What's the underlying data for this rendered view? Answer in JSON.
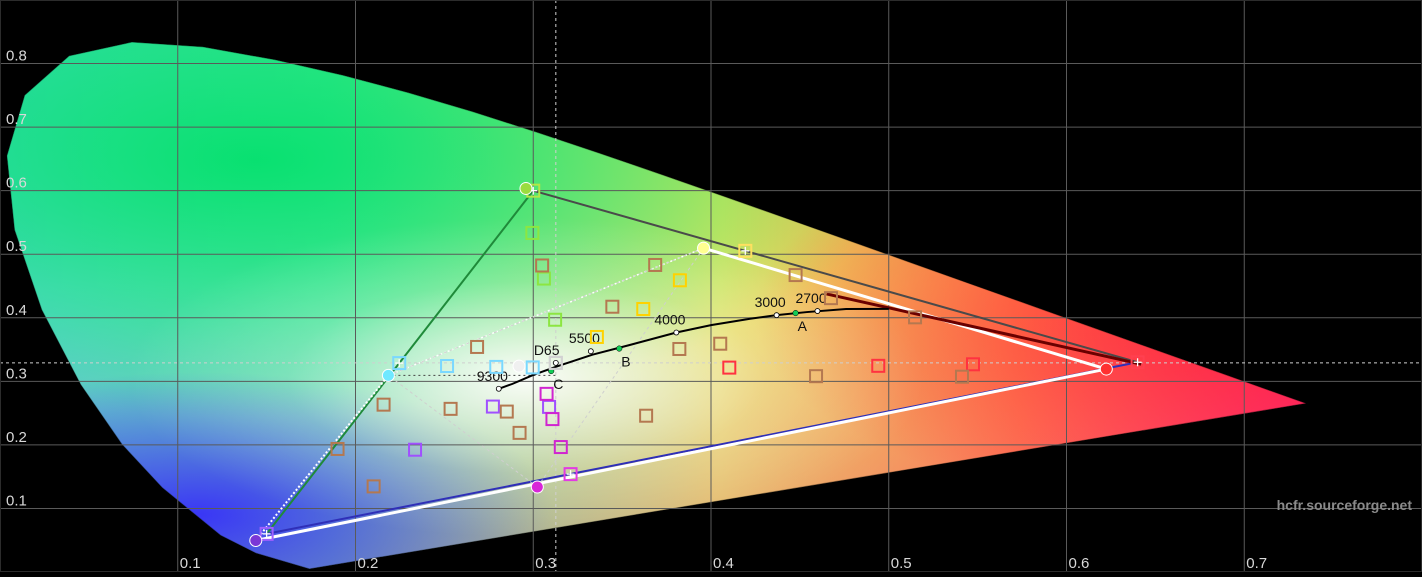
{
  "chart_data": {
    "type": "scatter",
    "xlim": [
      0,
      0.8
    ],
    "ylim": [
      0,
      0.9
    ],
    "grid": true,
    "x_ticks": [
      {
        "value": 0.1,
        "label": "0.1"
      },
      {
        "value": 0.2,
        "label": "0.2"
      },
      {
        "value": 0.3,
        "label": "0.3"
      },
      {
        "value": 0.4,
        "label": "0.4"
      },
      {
        "value": 0.5,
        "label": "0.5"
      },
      {
        "value": 0.6,
        "label": "0.6"
      },
      {
        "value": 0.7,
        "label": "0.7"
      }
    ],
    "y_ticks": [
      {
        "value": 0.1,
        "label": "0.1"
      },
      {
        "value": 0.2,
        "label": "0.2"
      },
      {
        "value": 0.3,
        "label": "0.3"
      },
      {
        "value": 0.4,
        "label": "0.4"
      },
      {
        "value": 0.5,
        "label": "0.5"
      },
      {
        "value": 0.6,
        "label": "0.6"
      },
      {
        "value": 0.7,
        "label": "0.7"
      },
      {
        "value": 0.8,
        "label": "0.8"
      }
    ],
    "watermark": "hcfr.sourceforge.net",
    "spectral_locus": [
      [
        0.1741,
        0.005
      ],
      [
        0.144,
        0.0297
      ],
      [
        0.1241,
        0.0578
      ],
      [
        0.0913,
        0.1327
      ],
      [
        0.0687,
        0.2007
      ],
      [
        0.0454,
        0.295
      ],
      [
        0.0235,
        0.4127
      ],
      [
        0.0082,
        0.5384
      ],
      [
        0.0039,
        0.6548
      ],
      [
        0.0139,
        0.7502
      ],
      [
        0.0389,
        0.812
      ],
      [
        0.0743,
        0.8338
      ],
      [
        0.1142,
        0.8262
      ],
      [
        0.1547,
        0.8059
      ],
      [
        0.1929,
        0.7816
      ],
      [
        0.2296,
        0.7543
      ],
      [
        0.2658,
        0.7243
      ],
      [
        0.3016,
        0.6923
      ],
      [
        0.3373,
        0.6589
      ],
      [
        0.3731,
        0.6245
      ],
      [
        0.4087,
        0.5896
      ],
      [
        0.4441,
        0.5547
      ],
      [
        0.4788,
        0.5202
      ],
      [
        0.5125,
        0.4866
      ],
      [
        0.5448,
        0.4544
      ],
      [
        0.5752,
        0.4242
      ],
      [
        0.6029,
        0.3965
      ],
      [
        0.627,
        0.3725
      ],
      [
        0.6482,
        0.3514
      ],
      [
        0.6658,
        0.334
      ],
      [
        0.6915,
        0.3083
      ],
      [
        0.7347,
        0.2653
      ]
    ],
    "gamut_reference": [
      [
        0.64,
        0.33
      ],
      [
        0.3,
        0.6
      ],
      [
        0.15,
        0.06
      ]
    ],
    "gamut_measured": [
      [
        0.6224,
        0.3193
      ],
      [
        0.2959,
        0.6035
      ],
      [
        0.1439,
        0.0496
      ]
    ],
    "white_to_primary_lines": [
      [
        [
          0.2185,
          0.3093
        ],
        [
          0.3958,
          0.5096
        ]
      ],
      [
        [
          0.2185,
          0.3093
        ],
        [
          0.1439,
          0.0496
        ]
      ]
    ],
    "secondary_triangle": [
      [
        0.3958,
        0.5096
      ],
      [
        0.3023,
        0.1337
      ],
      [
        0.2185,
        0.3093
      ]
    ],
    "planckian_locus": [
      [
        0.2806,
        0.2883
      ],
      [
        0.2883,
        0.296
      ],
      [
        0.3,
        0.31
      ],
      [
        0.3135,
        0.3236
      ],
      [
        0.3333,
        0.3419
      ],
      [
        0.354,
        0.357
      ],
      [
        0.3805,
        0.3768
      ],
      [
        0.4,
        0.3885
      ],
      [
        0.422,
        0.3985
      ],
      [
        0.4369,
        0.4041
      ],
      [
        0.454,
        0.409
      ],
      [
        0.476,
        0.4138
      ],
      [
        0.5,
        0.414
      ]
    ],
    "cct_labels": [
      {
        "label": "9300",
        "x": 0.2806,
        "y": 0.2883
      },
      {
        "label": "D65",
        "x": 0.3127,
        "y": 0.329
      },
      {
        "label": "5500",
        "x": 0.3324,
        "y": 0.3474
      },
      {
        "label": "4000",
        "x": 0.3805,
        "y": 0.3768
      },
      {
        "label": "3000",
        "x": 0.4369,
        "y": 0.4041
      },
      {
        "label": "2700",
        "x": 0.4599,
        "y": 0.4106
      }
    ],
    "illuminants": [
      {
        "label": "A",
        "x": 0.4476,
        "y": 0.4074
      },
      {
        "label": "B",
        "x": 0.3484,
        "y": 0.3516
      },
      {
        "label": "C",
        "x": 0.3101,
        "y": 0.3162
      }
    ],
    "crosshair": {
      "x": 0.3127,
      "y": 0.329
    },
    "white_reference_line": [
      [
        0.2185,
        0.3093
      ],
      [
        0.3127,
        0.3093
      ]
    ],
    "primary_measurements": [
      {
        "label": "red",
        "x": 0.6224,
        "y": 0.3193,
        "color": "#ff3030"
      },
      {
        "label": "green",
        "x": 0.2959,
        "y": 0.6035,
        "color": "#9bdc3f"
      },
      {
        "label": "blue",
        "x": 0.1439,
        "y": 0.0496,
        "color": "#7a37d6"
      },
      {
        "label": "magenta",
        "x": 0.3023,
        "y": 0.1337,
        "color": "#d826d8"
      },
      {
        "label": "yellow",
        "x": 0.3958,
        "y": 0.5096,
        "color": "#ffff90"
      },
      {
        "label": "cyan",
        "x": 0.2185,
        "y": 0.3093,
        "color": "#6fe8ff"
      }
    ],
    "target_markers": [
      {
        "x": 0.64,
        "y": 0.33,
        "color": "#ff4050",
        "type": "cross"
      },
      {
        "x": 0.3,
        "y": 0.6,
        "color": "#b4e646",
        "type": "cross"
      },
      {
        "x": 0.15,
        "y": 0.06,
        "color": "#a060ff",
        "type": "cross"
      },
      {
        "x": 0.321,
        "y": 0.154,
        "color": "#e23be2",
        "type": "cross"
      },
      {
        "x": 0.4193,
        "y": 0.5053,
        "color": "#ffe060",
        "type": "cross"
      },
      {
        "x": 0.2246,
        "y": 0.3287,
        "color": "#7ad8ff",
        "type": "cross"
      },
      {
        "x": 0.3127,
        "y": 0.329,
        "color": "#d2d2d2",
        "type": "square"
      },
      {
        "x": 0.3127,
        "y": 0.329,
        "color": "#d2d2d2",
        "type": "square"
      },
      {
        "x": 0.2995,
        "y": 0.5335,
        "color": "#8ce641",
        "type": "square"
      },
      {
        "x": 0.306,
        "y": 0.4617,
        "color": "#8ce641",
        "type": "square"
      },
      {
        "x": 0.3123,
        "y": 0.3969,
        "color": "#8ce641",
        "type": "square"
      },
      {
        "x": 0.3825,
        "y": 0.459,
        "color": "#ffd200",
        "type": "square"
      },
      {
        "x": 0.3619,
        "y": 0.4138,
        "color": "#ffd200",
        "type": "square"
      },
      {
        "x": 0.3358,
        "y": 0.3698,
        "color": "#ffd200",
        "type": "square"
      },
      {
        "x": 0.4941,
        "y": 0.3244,
        "color": "#ff3240",
        "type": "square"
      },
      {
        "x": 0.4103,
        "y": 0.3216,
        "color": "#ff3240",
        "type": "square"
      },
      {
        "x": 0.5474,
        "y": 0.3268,
        "color": "#ff3240",
        "type": "square"
      },
      {
        "x": 0.2515,
        "y": 0.3241,
        "color": "#7ad8ff",
        "type": "square"
      },
      {
        "x": 0.2792,
        "y": 0.3227,
        "color": "#7ad8ff",
        "type": "square"
      },
      {
        "x": 0.2997,
        "y": 0.3219,
        "color": "#7ad8ff",
        "type": "square"
      },
      {
        "x": 0.2335,
        "y": 0.1924,
        "color": "#a050ff",
        "type": "square"
      },
      {
        "x": 0.2773,
        "y": 0.2603,
        "color": "#a050ff",
        "type": "square"
      },
      {
        "x": 0.3089,
        "y": 0.2598,
        "color": "#a050ff",
        "type": "square"
      },
      {
        "x": 0.3075,
        "y": 0.2803,
        "color": "#d024d0",
        "type": "square"
      },
      {
        "x": 0.3108,
        "y": 0.2406,
        "color": "#d024d0",
        "type": "square"
      },
      {
        "x": 0.3155,
        "y": 0.1966,
        "color": "#d024d0",
        "type": "square"
      },
      {
        "x": 0.305,
        "y": 0.4823,
        "color": "#b47850",
        "type": "square"
      },
      {
        "x": 0.3445,
        "y": 0.4174,
        "color": "#b47850",
        "type": "square"
      },
      {
        "x": 0.3686,
        "y": 0.4831,
        "color": "#b47850",
        "type": "square"
      },
      {
        "x": 0.4476,
        "y": 0.4672,
        "color": "#b47850",
        "type": "square"
      },
      {
        "x": 0.4675,
        "y": 0.4309,
        "color": "#b47850",
        "type": "square"
      },
      {
        "x": 0.5148,
        "y": 0.4007,
        "color": "#b47850",
        "type": "square"
      },
      {
        "x": 0.3822,
        "y": 0.3509,
        "color": "#b47850",
        "type": "square"
      },
      {
        "x": 0.4052,
        "y": 0.3592,
        "color": "#b47850",
        "type": "square"
      },
      {
        "x": 0.4591,
        "y": 0.3081,
        "color": "#b47850",
        "type": "square"
      },
      {
        "x": 0.5412,
        "y": 0.3073,
        "color": "#b47850",
        "type": "square"
      },
      {
        "x": 0.2684,
        "y": 0.3541,
        "color": "#b47850",
        "type": "square"
      },
      {
        "x": 0.2535,
        "y": 0.2567,
        "color": "#b47850",
        "type": "square"
      },
      {
        "x": 0.2851,
        "y": 0.2524,
        "color": "#b47850",
        "type": "square"
      },
      {
        "x": 0.2923,
        "y": 0.2189,
        "color": "#b47850",
        "type": "square"
      },
      {
        "x": 0.2158,
        "y": 0.2633,
        "color": "#b47850",
        "type": "square"
      },
      {
        "x": 0.1899,
        "y": 0.1936,
        "color": "#b47850",
        "type": "square"
      },
      {
        "x": 0.2102,
        "y": 0.1347,
        "color": "#b47850",
        "type": "square"
      },
      {
        "x": 0.3635,
        "y": 0.2459,
        "color": "#b47850",
        "type": "square"
      }
    ],
    "measured_circles": [
      {
        "x": 0.6224,
        "y": 0.3193,
        "color": "#ff3030"
      },
      {
        "x": 0.2959,
        "y": 0.6035,
        "color": "#9bdc3f"
      },
      {
        "x": 0.1439,
        "y": 0.0496,
        "color": "#7a37d6"
      },
      {
        "x": 0.3023,
        "y": 0.1337,
        "color": "#d826d8"
      },
      {
        "x": 0.3958,
        "y": 0.5096,
        "color": "#ffff90"
      },
      {
        "x": 0.2185,
        "y": 0.3093,
        "color": "#6fe8ff"
      },
      {
        "x": 0.292,
        "y": 0.324,
        "color": "#f0f0f0"
      }
    ]
  }
}
